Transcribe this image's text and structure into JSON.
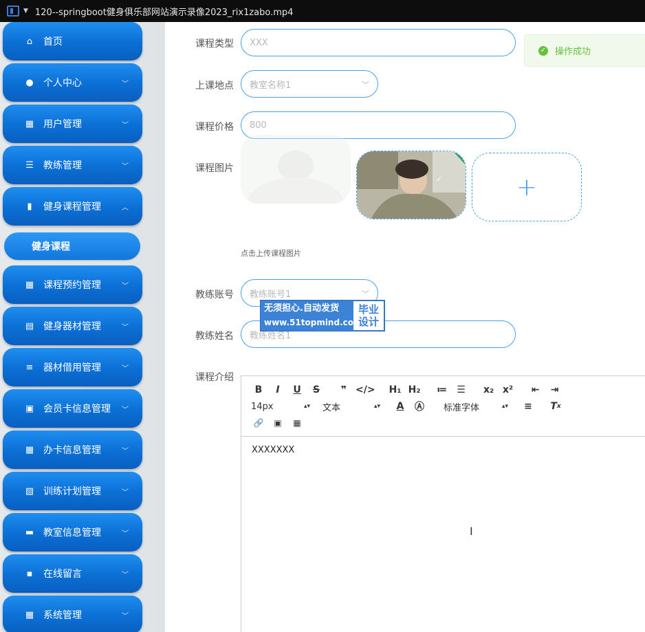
{
  "titlebar": {
    "title": "120--springboot健身俱乐部网站演示录像2023_rix1zabo.mp4"
  },
  "sidebar": {
    "items": [
      {
        "label": "首页",
        "icon": "home-icon",
        "glyph": "⌂",
        "chevron": ""
      },
      {
        "label": "个人中心",
        "icon": "user-icon",
        "glyph": "●",
        "chevron": "﹀"
      },
      {
        "label": "用户管理",
        "icon": "grid-icon",
        "glyph": "▦",
        "chevron": "﹀"
      },
      {
        "label": "教练管理",
        "icon": "sliders-icon",
        "glyph": "☰",
        "chevron": "﹀"
      },
      {
        "label": "健身课程管理",
        "icon": "book-icon",
        "glyph": "▮",
        "chevron": "︿"
      },
      {
        "label": "课程预约管理",
        "icon": "grid-icon",
        "glyph": "▦",
        "chevron": "﹀"
      },
      {
        "label": "健身器材管理",
        "icon": "clipboard-icon",
        "glyph": "▤",
        "chevron": "﹀"
      },
      {
        "label": "器材借用管理",
        "icon": "list-icon",
        "glyph": "≡",
        "chevron": "﹀"
      },
      {
        "label": "会员卡信息管理",
        "icon": "check-clipboard-icon",
        "glyph": "▣",
        "chevron": "﹀"
      },
      {
        "label": "办卡信息管理",
        "icon": "grid-icon",
        "glyph": "▦",
        "chevron": "﹀"
      },
      {
        "label": "训练计划管理",
        "icon": "x-clipboard-icon",
        "glyph": "▧",
        "chevron": "﹀"
      },
      {
        "label": "教室信息管理",
        "icon": "monitor-icon",
        "glyph": "▬",
        "chevron": "﹀"
      },
      {
        "label": "在线留言",
        "icon": "chat-icon",
        "glyph": "▪",
        "chevron": "﹀"
      },
      {
        "label": "系统管理",
        "icon": "grid-icon",
        "glyph": "▦",
        "chevron": "﹀"
      }
    ],
    "sub_item": "健身课程"
  },
  "toast": {
    "text": "操作成功",
    "color": "#67c23a"
  },
  "form": {
    "course_type": {
      "label": "课程类型",
      "placeholder": "XXX"
    },
    "location": {
      "label": "上课地点",
      "value": "教室名称1"
    },
    "price": {
      "label": "课程价格",
      "placeholder": "800"
    },
    "image": {
      "label": "课程图片",
      "tip": "点击上传课程图片"
    },
    "coach_account": {
      "label": "教练账号",
      "value": "教练账号1"
    },
    "coach_name": {
      "label": "教练姓名",
      "placeholder": "教练姓名1"
    },
    "intro": {
      "label": "课程介绍",
      "content": "XXXXXXX"
    }
  },
  "watermark": {
    "line1": "无须担心.自动发货",
    "line2": "www.51topmind.com",
    "right1": "毕业",
    "right2": "设计"
  },
  "editor": {
    "row1": [
      "B",
      "I",
      "U",
      "S",
      "❞",
      "</>",
      "H₁",
      "H₂",
      "≔",
      "☰",
      "x₂",
      "x²",
      "⇤",
      "⇥"
    ],
    "font_size": "14px",
    "block_type": "文本",
    "font_family": "标准字体",
    "row3": [
      "🔗",
      "▣",
      "▦"
    ]
  },
  "colors": {
    "accent": "#1f8ef1",
    "border": "#4aa0ef"
  }
}
